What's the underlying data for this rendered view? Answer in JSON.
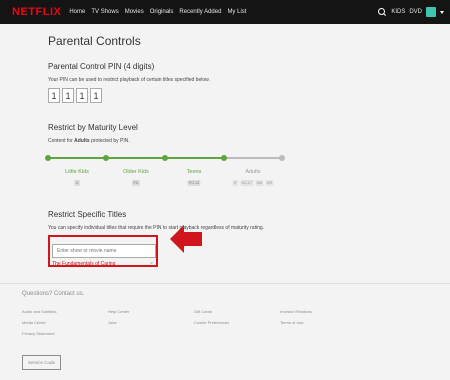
{
  "header": {
    "logo": "NETFLIX",
    "nav": [
      "Home",
      "TV Shows",
      "Movies",
      "Originals",
      "Recently Added",
      "My List"
    ],
    "kids": "KIDS",
    "dvd": "DVD"
  },
  "page": {
    "title": "Parental Controls"
  },
  "pin": {
    "heading": "Parental Control PIN (4 digits)",
    "description": "Your PIN can be used to restrict playback of certain titles specified below.",
    "digits": [
      "1",
      "1",
      "1",
      "1"
    ]
  },
  "maturity": {
    "heading": "Restrict by Maturity Level",
    "desc_prefix": "Content for ",
    "desc_bold": "Adults",
    "desc_suffix": " protected by PIN.",
    "levels": [
      {
        "label": "Little Kids",
        "ratings": [
          "G"
        ],
        "active": true
      },
      {
        "label": "Older Kids",
        "ratings": [
          "PG"
        ],
        "active": true
      },
      {
        "label": "Teens",
        "ratings": [
          "PG-13"
        ],
        "active": true
      },
      {
        "label": "Adults",
        "ratings": [
          "R",
          "NC-17",
          "MA",
          "UR"
        ],
        "active": false
      }
    ],
    "colors": {
      "active": "#5fa53f",
      "inactive": "#bbbbbb"
    }
  },
  "restrict": {
    "heading": "Restrict Specific Titles",
    "description": "You can specify individual titles that require the PIN to start playback regardless of maturity rating.",
    "search_placeholder": "Enter show or movie name",
    "titles": [
      "The Fundamentals of Caring"
    ],
    "remove_symbol": "×",
    "highlight_color": "#d0161c"
  },
  "footer": {
    "question": "Questions? Contact us.",
    "links": [
      "Audio and Subtitles",
      "Help Center",
      "Gift Cards",
      "Investor Relations",
      "Media Center",
      "Jobs",
      "Cookie Preferences",
      "Terms of Use",
      "Privacy Statement"
    ],
    "service_code": "Service Code"
  }
}
